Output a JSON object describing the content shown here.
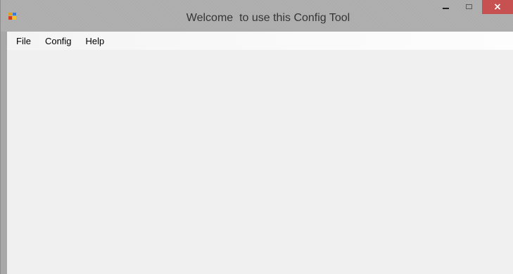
{
  "window": {
    "title": "Welcome  to use this Config Tool",
    "app_icon": "app-icon",
    "controls": {
      "minimize": "minimize-icon",
      "maximize": "maximize-icon",
      "close": "×"
    }
  },
  "menubar": {
    "items": [
      {
        "label": "File"
      },
      {
        "label": "Config"
      },
      {
        "label": "Help"
      }
    ]
  },
  "colors": {
    "titlebar": "#adadad",
    "close_button": "#c75050",
    "client_background": "#f0f0f0"
  }
}
